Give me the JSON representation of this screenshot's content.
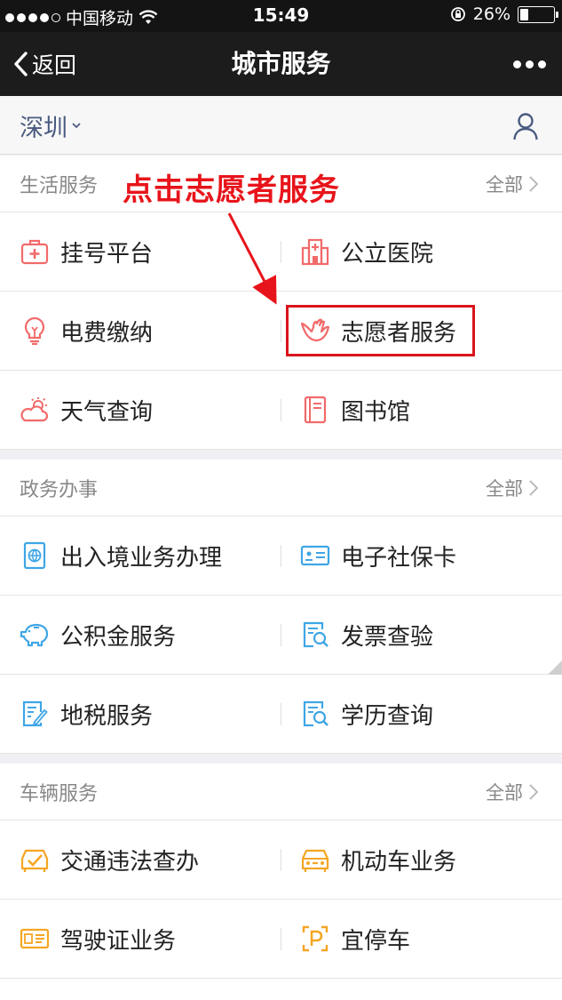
{
  "status_bar": {
    "carrier": "中国移动",
    "time": "15:49",
    "battery": "26%",
    "battery_level": 0.26
  },
  "nav": {
    "back_label": "返回",
    "title": "城市服务"
  },
  "city": {
    "name": "深圳"
  },
  "annotation": {
    "text": "点击志愿者服务"
  },
  "colors": {
    "red": "#f26a6a",
    "blue": "#3fa6e6",
    "orange": "#f5a623",
    "annotation": "#e8141b"
  },
  "sections": [
    {
      "title": "生活服务",
      "all_label": "全部",
      "items": [
        {
          "label": "挂号平台",
          "icon": "medical-kit-icon"
        },
        {
          "label": "公立医院",
          "icon": "hospital-icon"
        },
        {
          "label": "电费缴纳",
          "icon": "lightbulb-icon"
        },
        {
          "label": "志愿者服务",
          "icon": "helping-hand-icon"
        },
        {
          "label": "天气查询",
          "icon": "weather-icon"
        },
        {
          "label": "图书馆",
          "icon": "book-icon"
        }
      ]
    },
    {
      "title": "政务办事",
      "all_label": "全部",
      "items": [
        {
          "label": "出入境业务办理",
          "icon": "passport-icon"
        },
        {
          "label": "电子社保卡",
          "icon": "id-card-icon"
        },
        {
          "label": "公积金服务",
          "icon": "piggy-bank-icon"
        },
        {
          "label": "发票查验",
          "icon": "invoice-search-icon"
        },
        {
          "label": "地税服务",
          "icon": "tax-form-icon"
        },
        {
          "label": "学历查询",
          "icon": "document-search-icon"
        }
      ]
    },
    {
      "title": "车辆服务",
      "all_label": "全部",
      "items": [
        {
          "label": "交通违法查办",
          "icon": "traffic-violation-icon"
        },
        {
          "label": "机动车业务",
          "icon": "car-icon"
        },
        {
          "label": "驾驶证业务",
          "icon": "license-icon"
        },
        {
          "label": "宜停车",
          "icon": "parking-icon"
        }
      ]
    }
  ]
}
